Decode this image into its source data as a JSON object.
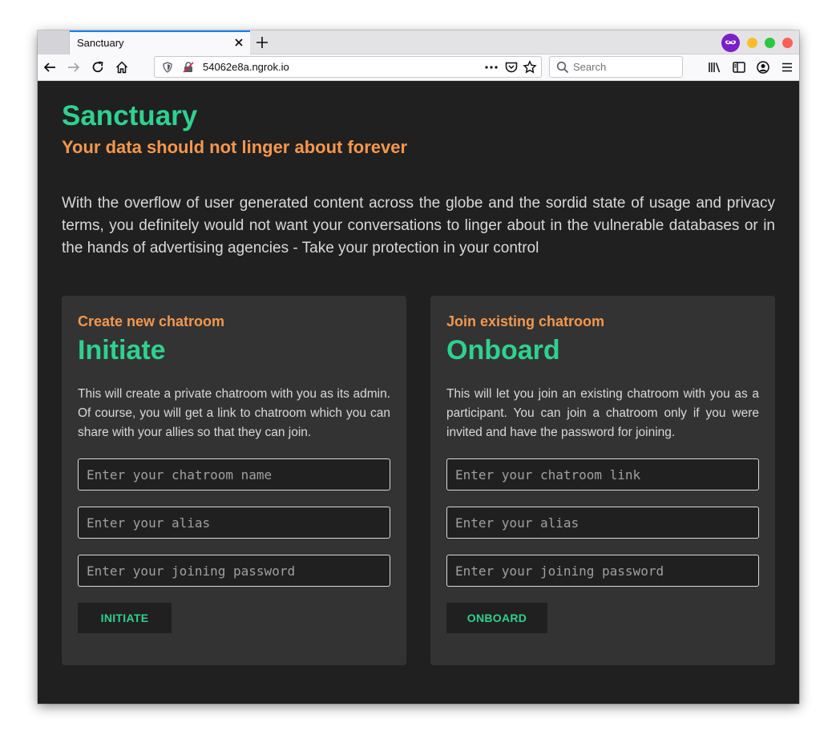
{
  "browser": {
    "tab_title": "Sanctuary",
    "url": "54062e8a.ngrok.io",
    "search_placeholder": "Search"
  },
  "page": {
    "brand": "Sanctuary",
    "tagline": "Your data should not linger about forever",
    "intro": "With the overflow of user generated content across the globe and the sordid state of usage and privacy terms, you definitely would not want your conversations to linger about in the vulnerable databases or in the hands of advertising agencies - Take your protection in your control"
  },
  "initiate": {
    "kicker": "Create new chatroom",
    "title": "Initiate",
    "description": "This will create a private chatroom with you as its admin. Of course, you will get a link to chatroom which you can share with your allies so that they can join.",
    "room_name_placeholder": "Enter your chatroom name",
    "alias_placeholder": "Enter your alias",
    "password_placeholder": "Enter your joining password",
    "button": "INITIATE"
  },
  "onboard": {
    "kicker": "Join existing chatroom",
    "title": "Onboard",
    "description": "This will let you join an existing chatroom with you as a participant. You can join a chatroom only if you were invited and have the password for joining.",
    "room_link_placeholder": "Enter your chatroom link",
    "alias_placeholder": "Enter your alias",
    "password_placeholder": "Enter your joining password",
    "button": "ONBOARD"
  },
  "colors": {
    "accent_green": "#2fd18f",
    "accent_orange": "#f4974e",
    "background": "#202020",
    "card": "#333333"
  }
}
